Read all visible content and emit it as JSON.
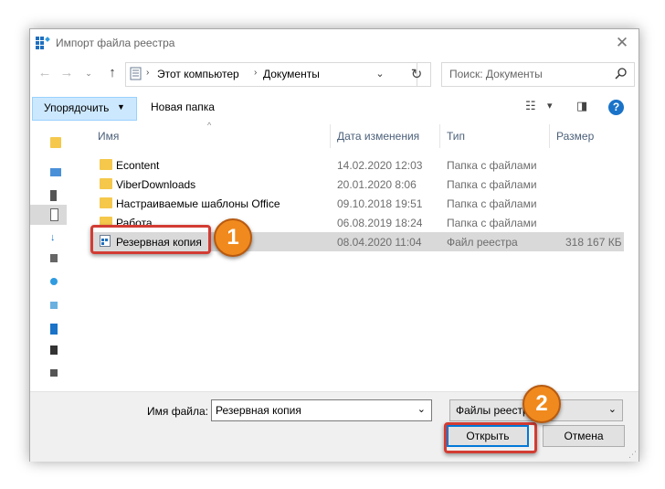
{
  "window": {
    "title": "Импорт файла реестра",
    "close_glyph": "✕"
  },
  "navigation": {
    "back_glyph": "←",
    "forward_glyph": "→",
    "up_glyph": "↑",
    "breadcrumbs": [
      "Этот компьютер",
      "Документы"
    ],
    "breadcrumb_sep": "›",
    "dropdown_glyph": "⌄",
    "refresh_glyph": "↻",
    "search_placeholder": "Поиск: Документы"
  },
  "toolbar": {
    "organize_label": "Упорядочить",
    "organize_caret": "▼",
    "new_folder_label": "Новая папка",
    "view_glyph": "☷",
    "view_caret": "▾",
    "pane_glyph": "◨",
    "help_glyph": "?"
  },
  "columns": {
    "name": "Имя",
    "date": "Дата изменения",
    "type": "Тип",
    "size": "Размер",
    "sort_glyph": "^"
  },
  "files": [
    {
      "name": "Econtent",
      "date": "14.02.2020 12:03",
      "type": "Папка с файлами",
      "size": "",
      "kind": "folder"
    },
    {
      "name": "ViberDownloads",
      "date": "20.01.2020 8:06",
      "type": "Папка с файлами",
      "size": "",
      "kind": "folder"
    },
    {
      "name": "Настраиваемые шаблоны Office",
      "date": "09.10.2018 19:51",
      "type": "Папка с файлами",
      "size": "",
      "kind": "folder"
    },
    {
      "name": "Работа",
      "date": "06.08.2019 18:24",
      "type": "Папка с файлами",
      "size": "",
      "kind": "folder"
    },
    {
      "name": "Резервная копия",
      "date": "08.04.2020 11:04",
      "type": "Файл реестра",
      "size": "318 167 КБ",
      "kind": "registry",
      "selected": true
    }
  ],
  "bottom": {
    "filename_label": "Имя файла:",
    "filename_value": "Резервная копия",
    "filetype_value": "Файлы реестра",
    "dropdown_glyph": "⌄",
    "open_label": "Открыть",
    "cancel_label": "Отмена"
  },
  "annotations": {
    "step1": "1",
    "step2": "2"
  },
  "colors": {
    "accent": "#0078d7",
    "highlight": "#d23c33",
    "badge": "#f08a1e",
    "folder": "#f5c84c",
    "selection": "#d9d9d9"
  }
}
